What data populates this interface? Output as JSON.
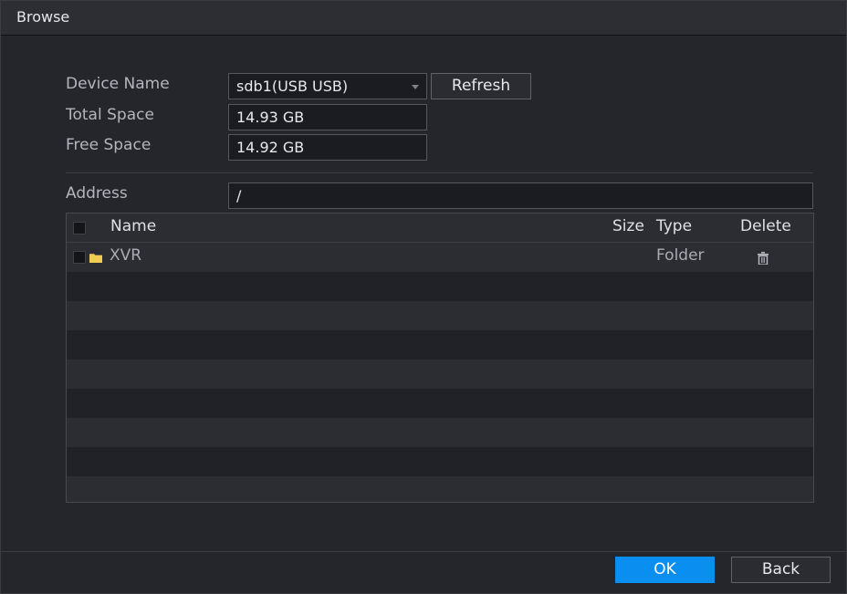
{
  "window": {
    "title": "Browse"
  },
  "form": {
    "device_name_label": "Device Name",
    "device_name_value": "sdb1(USB USB)",
    "refresh_label": "Refresh",
    "total_space_label": "Total Space",
    "total_space_value": "14.93 GB",
    "free_space_label": "Free Space",
    "free_space_value": "14.92 GB",
    "address_label": "Address",
    "address_value": "/"
  },
  "table": {
    "columns": {
      "name": "Name",
      "size": "Size",
      "type": "Type",
      "delete": "Delete"
    },
    "rows": [
      {
        "name": "XVR",
        "size": "",
        "type": "Folder",
        "icon": "folder-icon",
        "delete_icon": "trash-icon"
      }
    ]
  },
  "footer": {
    "ok_label": "OK",
    "back_label": "Back"
  },
  "colors": {
    "accent": "#0a8ef0",
    "folder": "#f2cb55"
  }
}
